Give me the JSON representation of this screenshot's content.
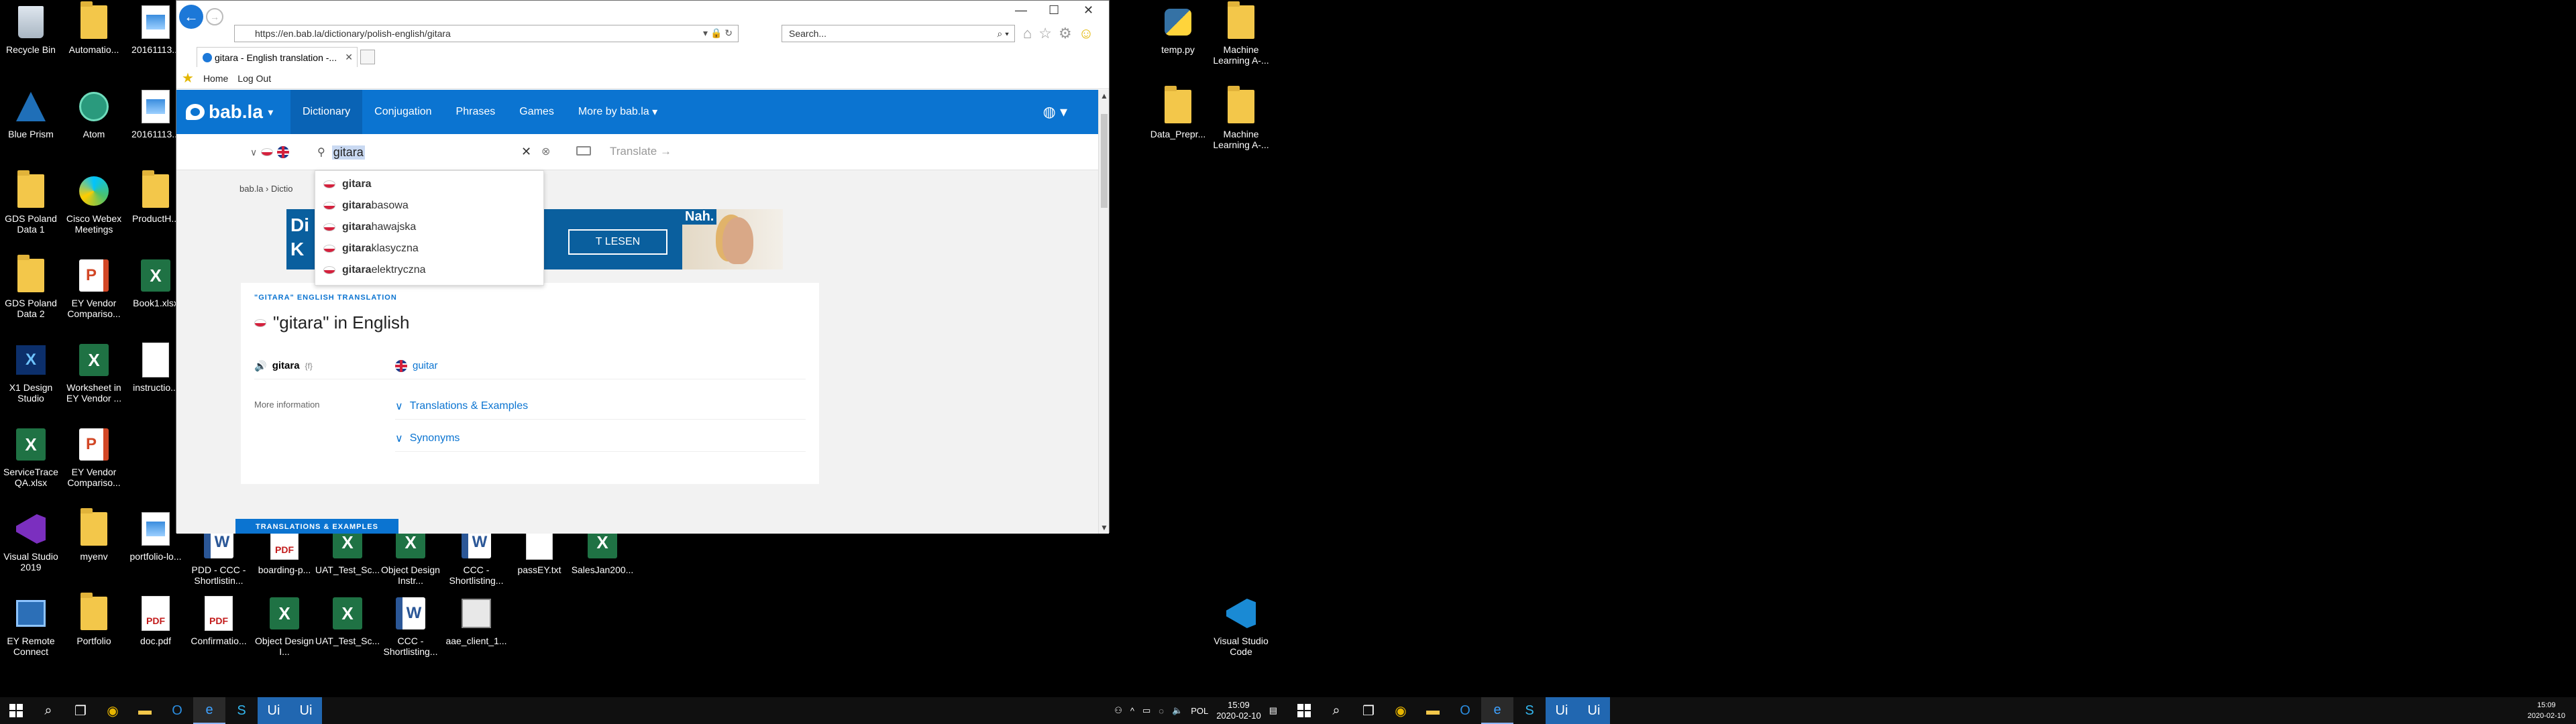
{
  "desktop": {
    "left_icons": [
      {
        "label": "Recycle Bin",
        "type": "recycle"
      },
      {
        "label": "Automatio...",
        "type": "folder"
      },
      {
        "label": "20161113...",
        "type": "image"
      },
      {
        "label": "Blue Prism",
        "type": "blueprism"
      },
      {
        "label": "Atom",
        "type": "atom"
      },
      {
        "label": "20161113...",
        "type": "image"
      },
      {
        "label": "GDS Poland Data 1",
        "type": "folder"
      },
      {
        "label": "Cisco Webex Meetings",
        "type": "webex"
      },
      {
        "label": "ProductH...",
        "type": "folder"
      },
      {
        "label": "GDS Poland Data 2",
        "type": "folder"
      },
      {
        "label": "EY Vendor Compariso...",
        "type": "ppt"
      },
      {
        "label": "Book1.xlsx",
        "type": "xl"
      },
      {
        "label": "X1 Design Studio",
        "type": "x1"
      },
      {
        "label": "Worksheet in EY Vendor ...",
        "type": "xl"
      },
      {
        "label": "instructio...",
        "type": "doc"
      },
      {
        "label": "ServiceTrace QA.xlsx",
        "type": "xl"
      },
      {
        "label": "EY Vendor Compariso...",
        "type": "ppt"
      },
      {
        "label": "Visual Studio 2019",
        "type": "vs"
      },
      {
        "label": "myenv",
        "type": "folder"
      },
      {
        "label": "portfolio-lo...",
        "type": "image"
      },
      {
        "label": "PDD - CCC - Shortlistin...",
        "type": "wd"
      },
      {
        "label": "boarding-p...",
        "type": "pdf"
      },
      {
        "label": "UAT_Test_Sc...",
        "type": "xl"
      },
      {
        "label": "Object Design Instr...",
        "type": "xl"
      },
      {
        "label": "CCC - Shortlisting...",
        "type": "wd"
      },
      {
        "label": "passEY.txt",
        "type": "doc"
      },
      {
        "label": "SalesJan200...",
        "type": "xl"
      },
      {
        "label": "EY Remote Connect",
        "type": "remote"
      },
      {
        "label": "Portfolio",
        "type": "folder"
      },
      {
        "label": "doc.pdf",
        "type": "pdf"
      },
      {
        "label": "Confirmatio...",
        "type": "pdf"
      },
      {
        "label": "Object Design I...",
        "type": "xl"
      },
      {
        "label": "UAT_Test_Sc...",
        "type": "xl"
      },
      {
        "label": "CCC - Shortlisting...",
        "type": "wd"
      },
      {
        "label": "aae_client_1...",
        "type": "aae"
      }
    ],
    "right_icons": [
      {
        "label": "temp.py",
        "type": "py"
      },
      {
        "label": "Machine Learning A-...",
        "type": "folder"
      },
      {
        "label": "Data_Prepr...",
        "type": "folder"
      },
      {
        "label": "Machine Learning A-...",
        "type": "folder"
      },
      {
        "label": "Visual Studio Code",
        "type": "vscode"
      }
    ]
  },
  "browser": {
    "url": "https://en.bab.la/dictionary/polish-english/gitara",
    "search_placeholder": "Search...",
    "tab_title": "gitara - English translation -...",
    "favorites": [
      "Home",
      "Log Out"
    ]
  },
  "site": {
    "logo": "bab.la",
    "nav": [
      "Dictionary",
      "Conjugation",
      "Phrases",
      "Games",
      "More by bab.la"
    ],
    "query": "gitara",
    "translate_label": "Translate",
    "breadcrumb": "bab.la  ›  Dictio",
    "ad": {
      "text": "Di\nK",
      "button": "T LESEN",
      "brand": "Nah."
    },
    "suggestions": [
      {
        "bold": "gitara",
        "rest": ""
      },
      {
        "bold": "gitara",
        "rest": " basowa"
      },
      {
        "bold": "gitara",
        "rest": " hawajska"
      },
      {
        "bold": "gitara",
        "rest": " klasyczna"
      },
      {
        "bold": "gitara",
        "rest": " elektryczna"
      }
    ],
    "card": {
      "kicker": "\"GITARA\" ENGLISH TRANSLATION",
      "heading": "\"gitara\" in English",
      "word": "gitara",
      "gender": "{f}",
      "translation": "guitar",
      "more_info": "More information",
      "expanders": [
        "Translations & Examples",
        "Synonyms"
      ]
    },
    "section_badge": "TRANSLATIONS & EXAMPLES"
  },
  "taskbar": {
    "lang": "POL",
    "time": "15:09",
    "date": "2020-02-10",
    "time2": "15:09",
    "date2": "2020-02-10"
  },
  "colors": {
    "accent": "#0b74d1",
    "ie_blue": "#1c78d8"
  }
}
